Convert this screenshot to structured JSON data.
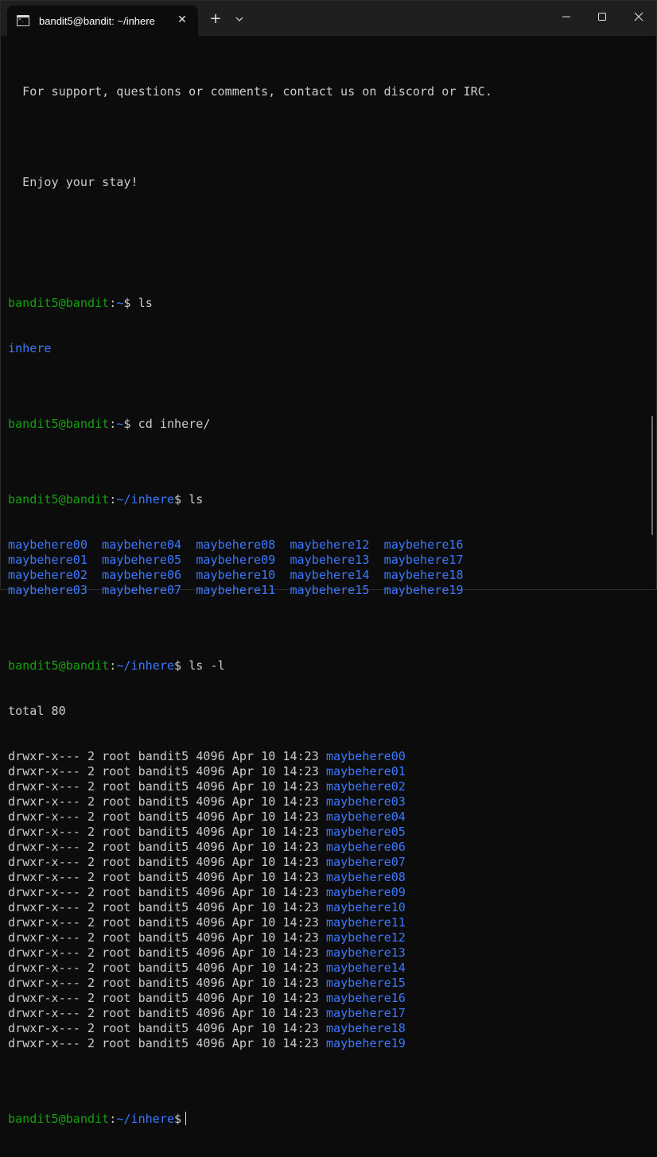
{
  "window": {
    "tab_title": "bandit5@bandit: ~/inhere",
    "tab_close_glyph": "✕",
    "new_tab_glyph": "+"
  },
  "terminal": {
    "motd": [
      "  For support, questions or comments, contact us on discord or IRC.",
      "",
      "  Enjoy your stay!",
      ""
    ],
    "prompt_user": "bandit5@bandit",
    "prompt_sep": ":",
    "commands": [
      {
        "path": "~",
        "cmd": "ls"
      },
      {
        "path": "~",
        "cmd": "cd inhere/"
      },
      {
        "path": "~/inhere",
        "cmd": "ls"
      },
      {
        "path": "~/inhere",
        "cmd": "ls -l"
      },
      {
        "path": "~/inhere",
        "cmd": ""
      }
    ],
    "ls_home_output": "inhere",
    "ls_grid": [
      [
        "maybehere00",
        "maybehere04",
        "maybehere08",
        "maybehere12",
        "maybehere16"
      ],
      [
        "maybehere01",
        "maybehere05",
        "maybehere09",
        "maybehere13",
        "maybehere17"
      ],
      [
        "maybehere02",
        "maybehere06",
        "maybehere10",
        "maybehere14",
        "maybehere18"
      ],
      [
        "maybehere03",
        "maybehere07",
        "maybehere11",
        "maybehere15",
        "maybehere19"
      ]
    ],
    "ls_l_total": "total 80",
    "ls_l_rows": [
      {
        "perm": "drwxr-x---",
        "links": "2",
        "owner": "root",
        "group": "bandit5",
        "size": "4096",
        "date": "Apr 10 14:23",
        "name": "maybehere00"
      },
      {
        "perm": "drwxr-x---",
        "links": "2",
        "owner": "root",
        "group": "bandit5",
        "size": "4096",
        "date": "Apr 10 14:23",
        "name": "maybehere01"
      },
      {
        "perm": "drwxr-x---",
        "links": "2",
        "owner": "root",
        "group": "bandit5",
        "size": "4096",
        "date": "Apr 10 14:23",
        "name": "maybehere02"
      },
      {
        "perm": "drwxr-x---",
        "links": "2",
        "owner": "root",
        "group": "bandit5",
        "size": "4096",
        "date": "Apr 10 14:23",
        "name": "maybehere03"
      },
      {
        "perm": "drwxr-x---",
        "links": "2",
        "owner": "root",
        "group": "bandit5",
        "size": "4096",
        "date": "Apr 10 14:23",
        "name": "maybehere04"
      },
      {
        "perm": "drwxr-x---",
        "links": "2",
        "owner": "root",
        "group": "bandit5",
        "size": "4096",
        "date": "Apr 10 14:23",
        "name": "maybehere05"
      },
      {
        "perm": "drwxr-x---",
        "links": "2",
        "owner": "root",
        "group": "bandit5",
        "size": "4096",
        "date": "Apr 10 14:23",
        "name": "maybehere06"
      },
      {
        "perm": "drwxr-x---",
        "links": "2",
        "owner": "root",
        "group": "bandit5",
        "size": "4096",
        "date": "Apr 10 14:23",
        "name": "maybehere07"
      },
      {
        "perm": "drwxr-x---",
        "links": "2",
        "owner": "root",
        "group": "bandit5",
        "size": "4096",
        "date": "Apr 10 14:23",
        "name": "maybehere08"
      },
      {
        "perm": "drwxr-x---",
        "links": "2",
        "owner": "root",
        "group": "bandit5",
        "size": "4096",
        "date": "Apr 10 14:23",
        "name": "maybehere09"
      },
      {
        "perm": "drwxr-x---",
        "links": "2",
        "owner": "root",
        "group": "bandit5",
        "size": "4096",
        "date": "Apr 10 14:23",
        "name": "maybehere10"
      },
      {
        "perm": "drwxr-x---",
        "links": "2",
        "owner": "root",
        "group": "bandit5",
        "size": "4096",
        "date": "Apr 10 14:23",
        "name": "maybehere11"
      },
      {
        "perm": "drwxr-x---",
        "links": "2",
        "owner": "root",
        "group": "bandit5",
        "size": "4096",
        "date": "Apr 10 14:23",
        "name": "maybehere12"
      },
      {
        "perm": "drwxr-x---",
        "links": "2",
        "owner": "root",
        "group": "bandit5",
        "size": "4096",
        "date": "Apr 10 14:23",
        "name": "maybehere13"
      },
      {
        "perm": "drwxr-x---",
        "links": "2",
        "owner": "root",
        "group": "bandit5",
        "size": "4096",
        "date": "Apr 10 14:23",
        "name": "maybehere14"
      },
      {
        "perm": "drwxr-x---",
        "links": "2",
        "owner": "root",
        "group": "bandit5",
        "size": "4096",
        "date": "Apr 10 14:23",
        "name": "maybehere15"
      },
      {
        "perm": "drwxr-x---",
        "links": "2",
        "owner": "root",
        "group": "bandit5",
        "size": "4096",
        "date": "Apr 10 14:23",
        "name": "maybehere16"
      },
      {
        "perm": "drwxr-x---",
        "links": "2",
        "owner": "root",
        "group": "bandit5",
        "size": "4096",
        "date": "Apr 10 14:23",
        "name": "maybehere17"
      },
      {
        "perm": "drwxr-x---",
        "links": "2",
        "owner": "root",
        "group": "bandit5",
        "size": "4096",
        "date": "Apr 10 14:23",
        "name": "maybehere18"
      },
      {
        "perm": "drwxr-x---",
        "links": "2",
        "owner": "root",
        "group": "bandit5",
        "size": "4096",
        "date": "Apr 10 14:23",
        "name": "maybehere19"
      }
    ]
  },
  "colors": {
    "background": "#0c0c0c",
    "titlebar": "#1f1f1f",
    "prompt_user": "#13a10e",
    "prompt_path": "#3b78ff",
    "directory": "#3b78ff",
    "text": "#cccccc"
  },
  "icons": {
    "tab": "terminal-icon",
    "tab_close": "close-icon",
    "new_tab": "plus-icon",
    "dropdown": "chevron-down-icon",
    "minimize": "minimize-icon",
    "maximize": "maximize-icon",
    "close": "close-icon"
  }
}
